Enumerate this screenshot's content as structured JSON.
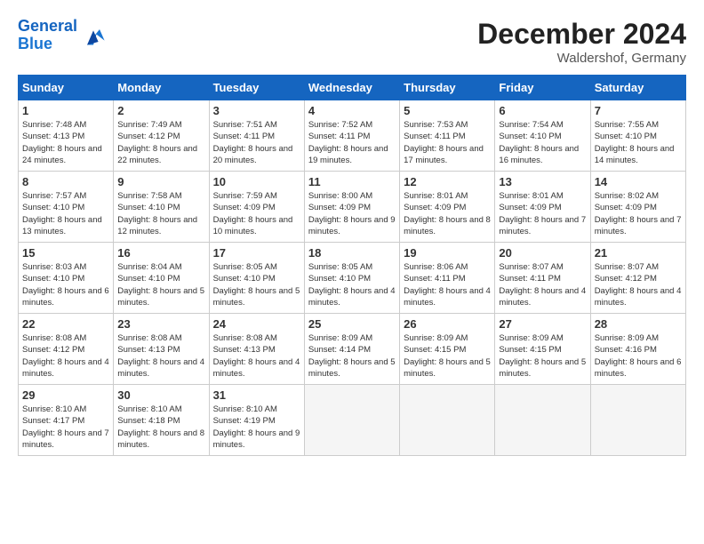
{
  "header": {
    "logo_line1": "General",
    "logo_line2": "Blue",
    "month": "December 2024",
    "location": "Waldershof, Germany"
  },
  "days_of_week": [
    "Sunday",
    "Monday",
    "Tuesday",
    "Wednesday",
    "Thursday",
    "Friday",
    "Saturday"
  ],
  "weeks": [
    [
      {
        "num": "1",
        "rise": "7:48 AM",
        "set": "4:13 PM",
        "daylight": "8 hours and 24 minutes"
      },
      {
        "num": "2",
        "rise": "7:49 AM",
        "set": "4:12 PM",
        "daylight": "8 hours and 22 minutes"
      },
      {
        "num": "3",
        "rise": "7:51 AM",
        "set": "4:11 PM",
        "daylight": "8 hours and 20 minutes"
      },
      {
        "num": "4",
        "rise": "7:52 AM",
        "set": "4:11 PM",
        "daylight": "8 hours and 19 minutes"
      },
      {
        "num": "5",
        "rise": "7:53 AM",
        "set": "4:11 PM",
        "daylight": "8 hours and 17 minutes"
      },
      {
        "num": "6",
        "rise": "7:54 AM",
        "set": "4:10 PM",
        "daylight": "8 hours and 16 minutes"
      },
      {
        "num": "7",
        "rise": "7:55 AM",
        "set": "4:10 PM",
        "daylight": "8 hours and 14 minutes"
      }
    ],
    [
      {
        "num": "8",
        "rise": "7:57 AM",
        "set": "4:10 PM",
        "daylight": "8 hours and 13 minutes"
      },
      {
        "num": "9",
        "rise": "7:58 AM",
        "set": "4:10 PM",
        "daylight": "8 hours and 12 minutes"
      },
      {
        "num": "10",
        "rise": "7:59 AM",
        "set": "4:09 PM",
        "daylight": "8 hours and 10 minutes"
      },
      {
        "num": "11",
        "rise": "8:00 AM",
        "set": "4:09 PM",
        "daylight": "8 hours and 9 minutes"
      },
      {
        "num": "12",
        "rise": "8:01 AM",
        "set": "4:09 PM",
        "daylight": "8 hours and 8 minutes"
      },
      {
        "num": "13",
        "rise": "8:01 AM",
        "set": "4:09 PM",
        "daylight": "8 hours and 7 minutes"
      },
      {
        "num": "14",
        "rise": "8:02 AM",
        "set": "4:09 PM",
        "daylight": "8 hours and 7 minutes"
      }
    ],
    [
      {
        "num": "15",
        "rise": "8:03 AM",
        "set": "4:10 PM",
        "daylight": "8 hours and 6 minutes"
      },
      {
        "num": "16",
        "rise": "8:04 AM",
        "set": "4:10 PM",
        "daylight": "8 hours and 5 minutes"
      },
      {
        "num": "17",
        "rise": "8:05 AM",
        "set": "4:10 PM",
        "daylight": "8 hours and 5 minutes"
      },
      {
        "num": "18",
        "rise": "8:05 AM",
        "set": "4:10 PM",
        "daylight": "8 hours and 4 minutes"
      },
      {
        "num": "19",
        "rise": "8:06 AM",
        "set": "4:11 PM",
        "daylight": "8 hours and 4 minutes"
      },
      {
        "num": "20",
        "rise": "8:07 AM",
        "set": "4:11 PM",
        "daylight": "8 hours and 4 minutes"
      },
      {
        "num": "21",
        "rise": "8:07 AM",
        "set": "4:12 PM",
        "daylight": "8 hours and 4 minutes"
      }
    ],
    [
      {
        "num": "22",
        "rise": "8:08 AM",
        "set": "4:12 PM",
        "daylight": "8 hours and 4 minutes"
      },
      {
        "num": "23",
        "rise": "8:08 AM",
        "set": "4:13 PM",
        "daylight": "8 hours and 4 minutes"
      },
      {
        "num": "24",
        "rise": "8:08 AM",
        "set": "4:13 PM",
        "daylight": "8 hours and 4 minutes"
      },
      {
        "num": "25",
        "rise": "8:09 AM",
        "set": "4:14 PM",
        "daylight": "8 hours and 5 minutes"
      },
      {
        "num": "26",
        "rise": "8:09 AM",
        "set": "4:15 PM",
        "daylight": "8 hours and 5 minutes"
      },
      {
        "num": "27",
        "rise": "8:09 AM",
        "set": "4:15 PM",
        "daylight": "8 hours and 5 minutes"
      },
      {
        "num": "28",
        "rise": "8:09 AM",
        "set": "4:16 PM",
        "daylight": "8 hours and 6 minutes"
      }
    ],
    [
      {
        "num": "29",
        "rise": "8:10 AM",
        "set": "4:17 PM",
        "daylight": "8 hours and 7 minutes"
      },
      {
        "num": "30",
        "rise": "8:10 AM",
        "set": "4:18 PM",
        "daylight": "8 hours and 8 minutes"
      },
      {
        "num": "31",
        "rise": "8:10 AM",
        "set": "4:19 PM",
        "daylight": "8 hours and 9 minutes"
      },
      null,
      null,
      null,
      null
    ]
  ],
  "labels": {
    "sunrise": "Sunrise:",
    "sunset": "Sunset:",
    "daylight": "Daylight:"
  }
}
